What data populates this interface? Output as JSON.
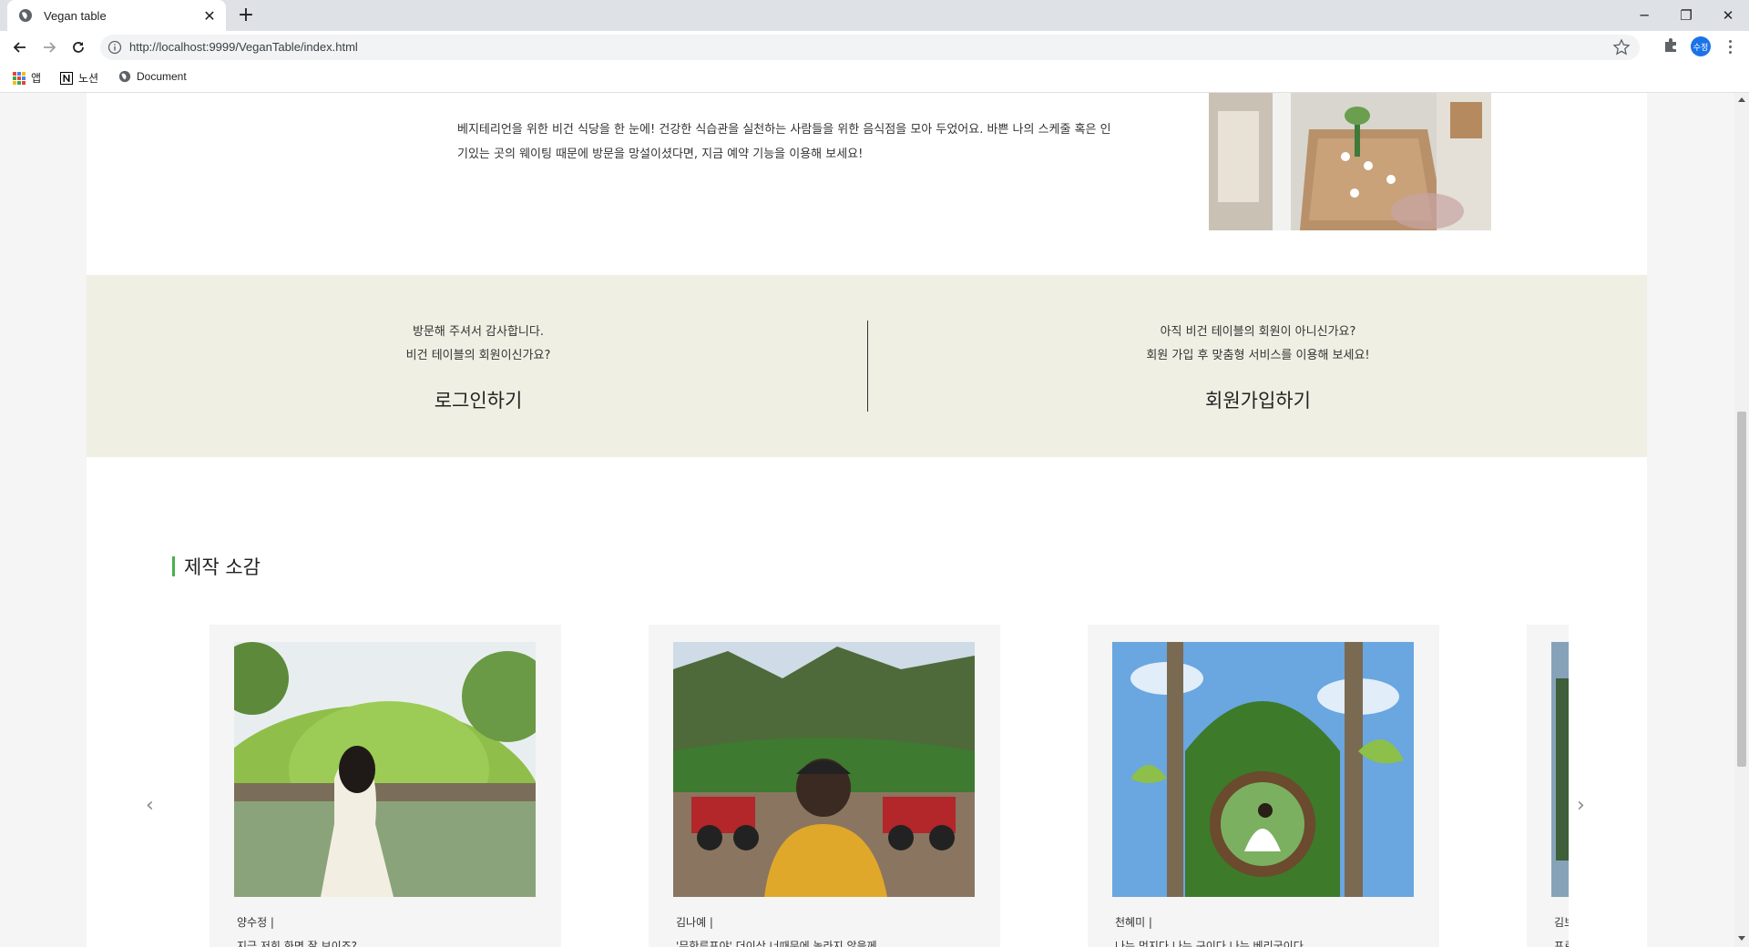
{
  "browser": {
    "tab_title": "Vegan table",
    "url": "http://localhost:9999/VeganTable/index.html",
    "profile_initials": "수정",
    "bookmarks": [
      "앱",
      "노션",
      "Document"
    ]
  },
  "intro": {
    "text": "베지테리언을 위한 비건 식당을 한 눈에! 건강한 식습관을 실천하는 사람들을 위한 음식점을 모아 두었어요. 바쁜 나의 스케줄 혹은 인기있는 곳의 웨이팅 때문에 방문을 망설이셨다면, 지금 예약 기능을 이용해 보세요!"
  },
  "membership": {
    "login": {
      "line1": "방문해 주셔서 감사합니다.",
      "line2": "비건 테이블의 회원이신가요?",
      "cta": "로그인하기"
    },
    "signup": {
      "line1": "아직 비건 테이블의 회원이 아니신가요?",
      "line2": "회원 가입 후 맞춤형 서비스를 이용해 보세요!",
      "cta": "회원가입하기"
    }
  },
  "reviews": {
    "title": "제작 소감",
    "cards": [
      {
        "name": "양수정  |",
        "message": "지금 저희 화면 잘 보이죠?........"
      },
      {
        "name": "김나예  |",
        "message": "'무한루프야' 더이상 너때문에 놀라지 않을께"
      },
      {
        "name": "천혜미  |",
        "message": "나는 멋지다 나는 구이다 나는 베리굿이다"
      },
      {
        "name": "김보",
        "message": "프로"
      }
    ],
    "prev_arrow": "‹",
    "next_arrow": "›"
  },
  "colors": {
    "accent": "#4caf50",
    "band": "#efefe4",
    "card": "#f5f5f5"
  }
}
